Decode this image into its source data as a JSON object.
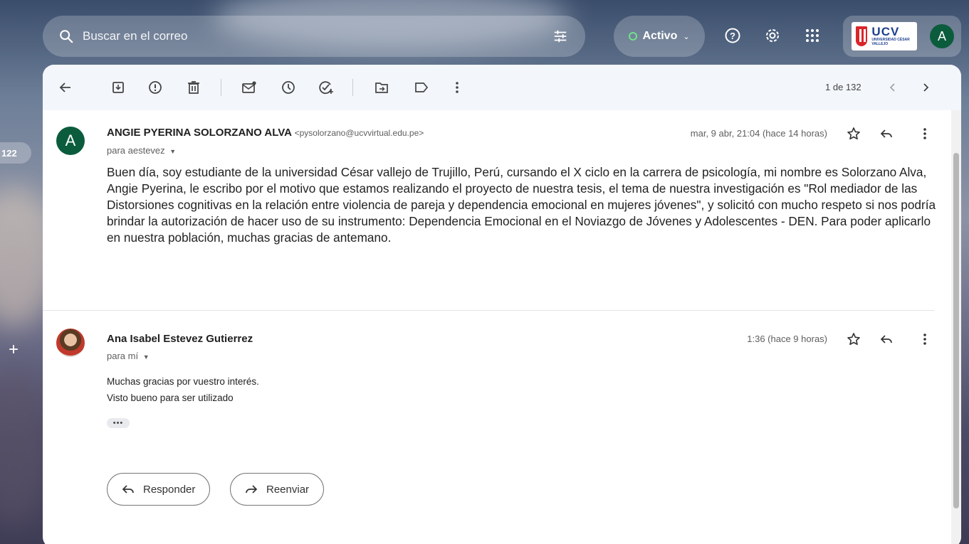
{
  "search": {
    "placeholder": "Buscar en el correo"
  },
  "status": {
    "label": "Activo"
  },
  "header": {
    "logo_text": "UCV",
    "logo_subtext": "UNIVERSIDAD CÉSAR VALLEJO",
    "account_initial": "A"
  },
  "side": {
    "badge": "122"
  },
  "toolbar": {
    "pager": "1 de 132"
  },
  "messages": [
    {
      "avatar_initial": "A",
      "sender_name": "ANGIE PYERINA SOLORZANO ALVA",
      "sender_email": "<pysolorzano@ucvvirtual.edu.pe>",
      "recipient": "para aestevez",
      "date": "mar, 9 abr, 21:04 (hace 14 horas)",
      "body": "Buen día, soy estudiante de la universidad César vallejo de Trujillo, Perú, cursando el X ciclo en la carrera de psicología, mi nombre es  Solorzano Alva, Angie Pyerina, le escribo por el motivo que estamos realizando el proyecto de nuestra tesis, el tema de nuestra investigación es \"Rol mediador de las Distorsiones cognitivas en la relación entre violencia de pareja y dependencia emocional en mujeres jóvenes\", y solicitó con mucho respeto si nos podría brindar la autorización de hacer uso de su instrumento: Dependencia Emocional en el Noviazgo de Jóvenes y Adolescentes - DEN. Para poder aplicarlo en nuestra población, muchas gracias de antemano."
    },
    {
      "sender_name": "Ana Isabel Estevez Gutierrez",
      "recipient": "para mí",
      "date": "1:36 (hace 9 horas)",
      "body_lines": [
        "Muchas gracias por vuestro interés.",
        "Visto bueno para ser utilizado"
      ],
      "trimmed": "•••"
    }
  ],
  "actions": {
    "reply": "Responder",
    "forward": "Reenviar"
  },
  "colors": {
    "accent_green": "#0b5c3d",
    "status_green": "#6fe28c",
    "brand_red": "#d9262a",
    "brand_blue": "#1c3f8f"
  }
}
